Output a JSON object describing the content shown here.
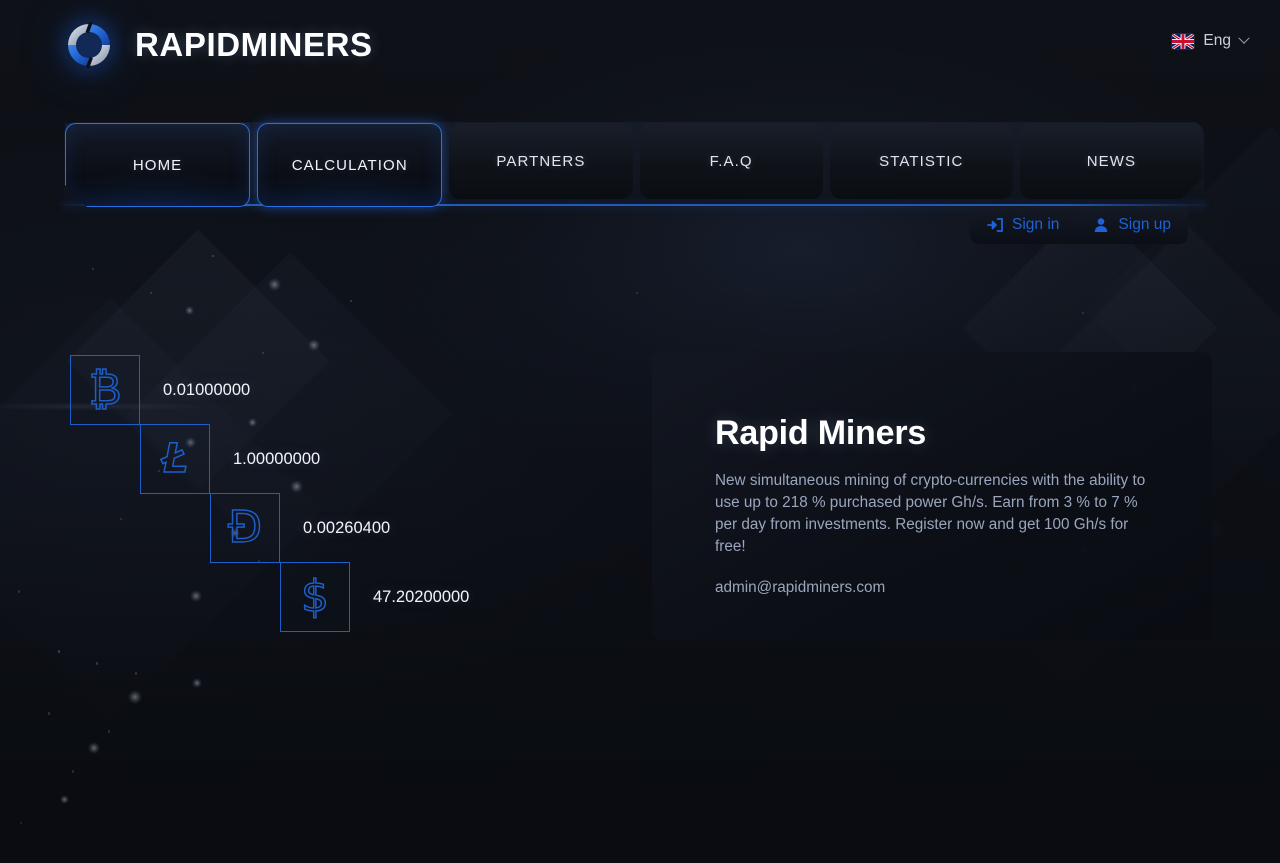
{
  "header": {
    "brand_title": "RAPIDMINERS",
    "logo_icon": "ring-logo-icon",
    "language": {
      "flag_icon": "uk-flag-icon",
      "label": "Eng",
      "chevron_icon": "chevron-down-icon"
    }
  },
  "nav": {
    "tabs": [
      {
        "label": "HOME",
        "active": true,
        "notch": "left"
      },
      {
        "label": "CALCULATION",
        "active": true,
        "notch": "none"
      },
      {
        "label": "PARTNERS",
        "active": false,
        "notch": "none"
      },
      {
        "label": "F.A.Q",
        "active": false,
        "notch": "none"
      },
      {
        "label": "STATISTIC",
        "active": false,
        "notch": "none"
      },
      {
        "label": "NEWS",
        "active": false,
        "notch": "right"
      }
    ]
  },
  "auth": {
    "sign_in": {
      "label": "Sign in",
      "icon": "sign-in-arrow-icon"
    },
    "sign_up": {
      "label": "Sign up",
      "icon": "user-icon"
    }
  },
  "coins": [
    {
      "name": "bitcoin",
      "glyph": "₿",
      "amount": "0.01000000"
    },
    {
      "name": "litecoin",
      "glyph": "Ł",
      "amount": "1.00000000"
    },
    {
      "name": "dogecoin",
      "glyph": "Ð",
      "amount": "0.00260400"
    },
    {
      "name": "dollar",
      "glyph": "$",
      "amount": "47.20200000"
    }
  ],
  "info_panel": {
    "title": "Rapid Miners",
    "description": "New simultaneous mining of crypto-currencies with the ability to use up to 218 % purchased power Gh/s. Earn from 3 % to 7 % per day from investments. Register now and get 100 Gh/s for free!",
    "email": "admin@rapidminers.com"
  },
  "colors": {
    "accent_blue": "#2c6fe0",
    "coin_outline": "#1d5ec9",
    "link_blue": "#1f62d6",
    "page_bg": "#0b0d12",
    "text_primary": "#ffffff",
    "text_muted": "#9aa6bd"
  }
}
